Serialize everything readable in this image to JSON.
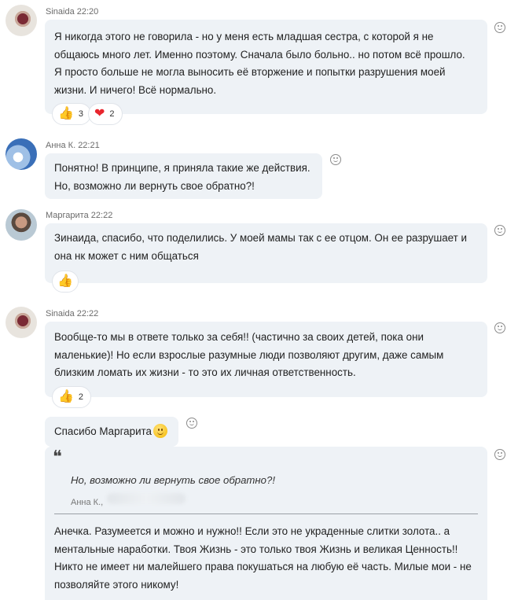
{
  "messages": [
    {
      "author": "Sinaida",
      "time": "22:20",
      "lines": [
        "Я никогда этого не говорила - но у меня есть младшая сестра, с которой я не",
        "общаюсь много лет. Именно поэтому. Сначала было больно.. но потом всё прошло.",
        "Я просто больше не могла выносить её вторжение и попытки разрушения моей",
        "жизни. И ничего! Всё нормально."
      ],
      "reactions": [
        {
          "icon": "thumbs-up-icon",
          "glyph": "👍",
          "count": "3"
        },
        {
          "icon": "heart-icon",
          "glyph": "❤",
          "count": "2"
        }
      ]
    },
    {
      "author": "Анна К.",
      "time": "22:21",
      "lines": [
        "Понятно! В принципе, я приняла такие же действия.",
        "Но, возможно ли вернуть свое обратно?!"
      ]
    },
    {
      "author": "Маргарита",
      "time": "22:22",
      "lines": [
        "Зинаида, спасибо, что поделились. У моей мамы так с ее отцом. Он ее разрушает и",
        "она нк может с ним общаться"
      ],
      "reactions": [
        {
          "icon": "thumbs-up-icon",
          "glyph": "👍",
          "count": ""
        }
      ]
    },
    {
      "author": "Sinaida",
      "time": "22:22",
      "lines": [
        "Вообще-то мы в ответе только за себя!! (частично за своих детей, пока они",
        "маленькие)! Но если взрослые разумные люди позволяют другим, даже самым",
        "близким ломать их жизни - то это их личная ответственность."
      ],
      "reactions": [
        {
          "icon": "thumbs-up-icon",
          "glyph": "👍",
          "count": "2"
        }
      ]
    },
    {
      "text": "Спасибо Маргарита"
    },
    {
      "quote": {
        "mark": "❝",
        "text": "Но, возможно ли вернуть свое обратно?!",
        "author": "Анна К.,"
      },
      "lines": [
        "Анечка. Разумеется и можно и нужно!! Если это не украденные слитки золота.. а",
        "ментальные наработки. Твоя Жизнь - это только твоя Жизнь и великая Ценность!!",
        "Никто не имеет ни малейшего права покушаться на любую её часть. Милые мои - не",
        "позволяйте этого никому!"
      ]
    }
  ],
  "colors": {
    "bubble": "#eef2f6",
    "meta_text": "#6b6b6b",
    "heart": "#e8262e",
    "thumb": "#f3b234"
  }
}
